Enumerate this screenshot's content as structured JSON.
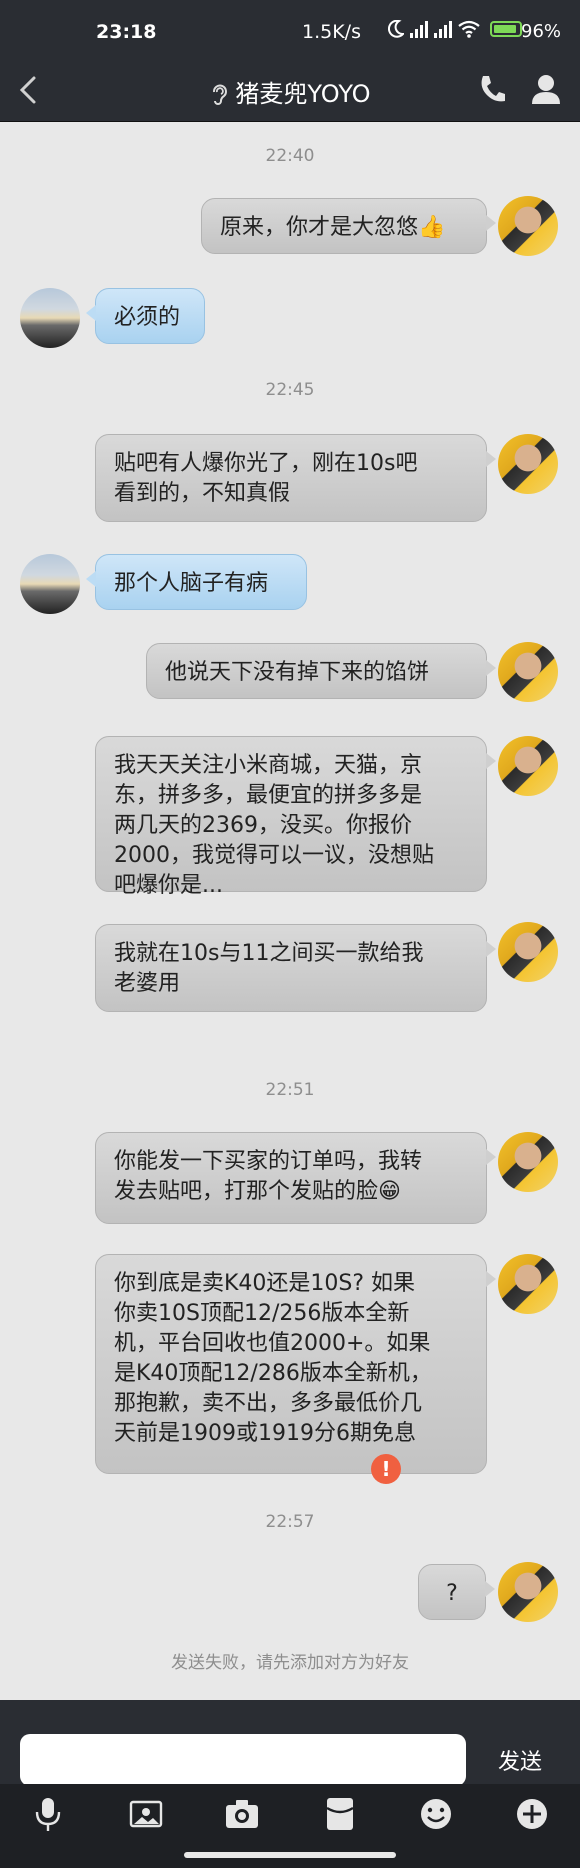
{
  "status_bar": {
    "time": "23:18",
    "net_speed": "1.5K/s",
    "battery_percent": "96%",
    "icons": [
      "moon-icon",
      "signal-hd-icon",
      "signal-hd-icon",
      "wifi-icon",
      "battery-charging-icon"
    ]
  },
  "header": {
    "title": "猪麦兜YOYO",
    "icons": [
      "back-icon",
      "ear-icon",
      "phone-icon",
      "person-icon"
    ]
  },
  "messages": [
    {
      "type": "timestamp",
      "text": "22:40"
    },
    {
      "type": "bubble",
      "side": "me",
      "lines": [
        "原来，你才是大忽悠"
      ],
      "emoji": "👍"
    },
    {
      "type": "bubble",
      "side": "them",
      "lines": [
        "必须的"
      ]
    },
    {
      "type": "timestamp",
      "text": "22:45"
    },
    {
      "type": "bubble",
      "side": "me",
      "lines": [
        "贴吧有人爆你光了，刚在10s吧",
        "看到的，不知真假"
      ]
    },
    {
      "type": "bubble",
      "side": "them",
      "lines": [
        "那个人脑子有病"
      ]
    },
    {
      "type": "bubble",
      "side": "me",
      "lines": [
        "他说天下没有掉下来的馅饼"
      ]
    },
    {
      "type": "bubble",
      "side": "me",
      "lines": [
        "我天天关注小米商城，天猫，京",
        "东，拼多多，最便宜的拼多多是",
        "两几天的2369，没买。你报价",
        "2000，我觉得可以一议，没想贴",
        "吧爆你是..."
      ]
    },
    {
      "type": "bubble",
      "side": "me",
      "lines": [
        "我就在10s与11之间买一款给我",
        "老婆用"
      ]
    },
    {
      "type": "timestamp",
      "text": "22:51"
    },
    {
      "type": "bubble",
      "side": "me",
      "lines": [
        "你能发一下买家的订单吗，我转",
        "发去贴吧，打那个发贴的脸"
      ],
      "emoji": "😁"
    },
    {
      "type": "bubble",
      "side": "me",
      "lines": [
        "你到底是卖K40还是10S? 如果",
        "你卖10S顶配12/256版本全新",
        "机，平台回收也值2000+。如果",
        "是K40顶配12/286版本全新机，",
        "那抱歉，卖不出，多多最低价几",
        "天前是1909或1919分6期免息"
      ]
    },
    {
      "type": "timestamp",
      "text": "22:57"
    },
    {
      "type": "bubble",
      "side": "me",
      "lines": [
        "?"
      ],
      "status": "failed"
    }
  ],
  "error_glyph": "!",
  "fail_notice": "发送失败，请先添加对方为好友",
  "input": {
    "value": "",
    "placeholder": "",
    "send_label": "发送"
  },
  "toolbar": [
    "microphone-icon",
    "image-icon",
    "camera-icon",
    "red-packet-icon",
    "emoji-icon",
    "plus-icon"
  ],
  "colors": {
    "bar_bg": "#2a2d33",
    "chat_bg": "#e8e8e8",
    "me_bubble": "#cfcfcf",
    "them_bubble": "#bcdcf4",
    "error": "#f06040",
    "battery": "#7ed957"
  }
}
